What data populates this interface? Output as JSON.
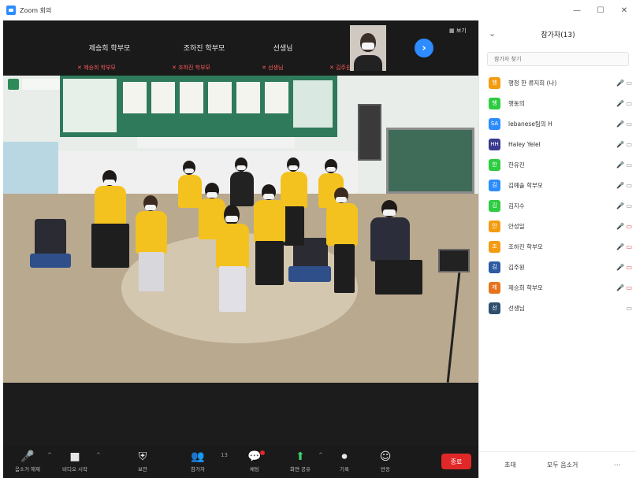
{
  "window": {
    "title": "Zoom 회의",
    "controls": [
      "—",
      "☐",
      "✕"
    ]
  },
  "thumbnails": [
    {
      "name": "제승희 학부모",
      "sub": "제승희 학부모"
    },
    {
      "name": "조하진 학부모",
      "sub": "조하진 학부모"
    },
    {
      "name": "선생님",
      "sub": "선생님"
    },
    {
      "name": "",
      "sub": "김주원"
    }
  ],
  "view": {
    "label": "보기"
  },
  "participants_panel": {
    "title": "참가자(13)",
    "search_placeholder": "참가자 찾기",
    "participants": [
      {
        "initial": "행",
        "name": "행정 한 류지희 (나)",
        "color": "#f39c12",
        "mic": "🎤 ▭",
        "muted": false
      },
      {
        "initial": "행",
        "name": "행동의",
        "color": "#2ecc40",
        "mic": "🎤 ▭",
        "muted": false
      },
      {
        "initial": "SA",
        "name": "lebanese팀의 H",
        "color": "#2d8cff",
        "mic": "🎤 ▭",
        "muted": false
      },
      {
        "initial": "HH",
        "name": "Haley Yelel",
        "color": "#3b3b8f",
        "mic": "🎤 ▭",
        "muted": false
      },
      {
        "initial": "한",
        "name": "한유진",
        "color": "#2ecc40",
        "mic": "🎤 ▭",
        "muted": false
      },
      {
        "initial": "김",
        "name": "김예솔 학부모",
        "color": "#2d8cff",
        "mic": "🎤 ▭",
        "muted": false
      },
      {
        "initial": "김",
        "name": "김지수",
        "color": "#2ecc40",
        "mic": "🎤 ▭",
        "muted": false
      },
      {
        "initial": "안",
        "name": "안성일",
        "color": "#f39c12",
        "mic": "🎤 ▭",
        "muted": true
      },
      {
        "initial": "조",
        "name": "조하진 학부모",
        "color": "#f39c12",
        "mic": "🎤 ▭",
        "muted": true
      },
      {
        "initial": "김",
        "name": "김주원",
        "color": "#2d5aa0",
        "mic": "🎤 ▭",
        "muted": true
      },
      {
        "initial": "제",
        "name": "제승희 학부모",
        "color": "#e8731e",
        "mic": "🎤 ▭",
        "muted": true
      },
      {
        "initial": "선",
        "name": "선생님",
        "color": "#2f4f6f",
        "mic": "▭",
        "muted": false
      }
    ],
    "footer": {
      "invite": "초대",
      "mute_all": "모두 음소거",
      "more": "..."
    }
  },
  "toolbar": {
    "buttons": [
      {
        "icon": "🎤",
        "label": "음소거 해제"
      },
      {
        "icon": "■",
        "label": "비디오 시작"
      },
      {
        "icon": "⛨",
        "label": "보안"
      },
      {
        "icon": "👥",
        "label": "참가자"
      },
      {
        "icon": "💬",
        "label": "채팅"
      },
      {
        "icon": "⬆",
        "label": "화면 공유"
      },
      {
        "icon": "⏺",
        "label": "기록"
      },
      {
        "icon": "☺",
        "label": "반응"
      }
    ],
    "participant_count": "13",
    "end_label": "종료"
  }
}
